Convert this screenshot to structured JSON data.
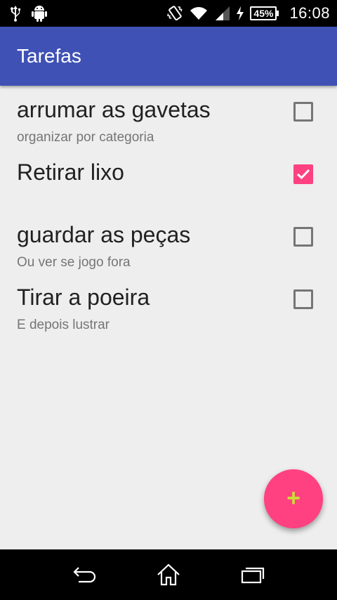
{
  "status_bar": {
    "battery": "45%",
    "time": "16:08",
    "icons": [
      "usb-icon",
      "android-icon",
      "vibrate-icon",
      "wifi-icon",
      "signal-icon",
      "charging-icon",
      "battery-icon"
    ]
  },
  "app_bar": {
    "title": "Tarefas",
    "color": "#3f51b5"
  },
  "tasks": [
    {
      "title": "arrumar as gavetas",
      "subtitle": "organizar por categoria",
      "checked": false
    },
    {
      "title": "Retirar lixo",
      "subtitle": "",
      "checked": true
    },
    {
      "title": "guardar as peças",
      "subtitle": "Ou ver se jogo fora",
      "checked": false
    },
    {
      "title": "Tirar a poeira",
      "subtitle": "E depois lustrar",
      "checked": false
    }
  ],
  "fab": {
    "label": "+",
    "color": "#ff4081",
    "icon_color": "#cddc39"
  },
  "nav_bar": {
    "icons": [
      "back-icon",
      "home-icon",
      "recents-icon"
    ]
  },
  "colors": {
    "accent": "#ff4081",
    "primary": "#3f51b5",
    "background": "#eeeeee"
  }
}
